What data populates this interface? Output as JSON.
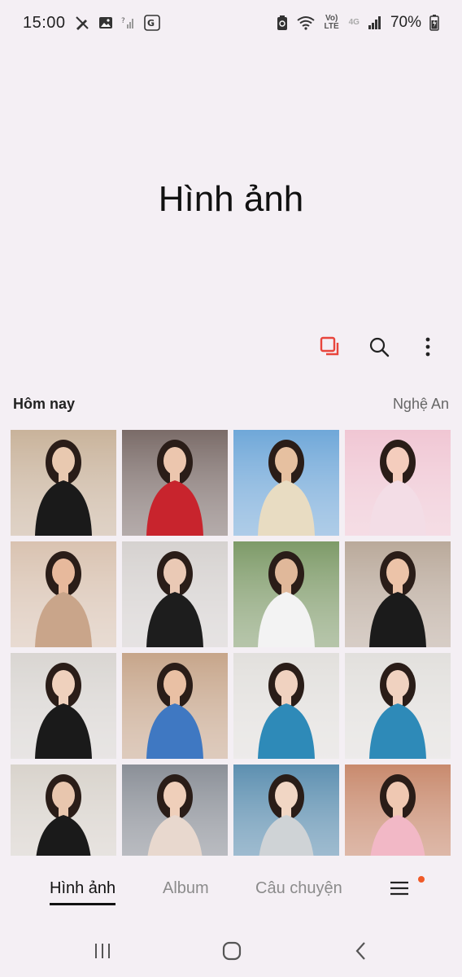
{
  "status_bar": {
    "time": "15:00",
    "left_icons": [
      "pen-off-icon",
      "image-icon",
      "signal-question-icon",
      "translate-icon"
    ],
    "right_icons": [
      "recycle-icon",
      "wifi-icon",
      "volte-icon",
      "4g-icon",
      "signal-icon",
      "battery-icon"
    ],
    "volte_label": "Vo) LTE",
    "network_label": "4G",
    "battery_percent": "70%"
  },
  "title": "Hình ảnh",
  "toolbar": {
    "icons": [
      "select-icon",
      "search-icon",
      "more-options-icon"
    ],
    "accent_color": "#e8453c"
  },
  "section": {
    "date_label": "Hôm nay",
    "location_label": "Nghệ An"
  },
  "photos": [
    {
      "bg": "#c9b39a",
      "accent": "#1a1a1a",
      "skin": "#e9c9b0"
    },
    {
      "bg": "#7a6b68",
      "accent": "#c8242d",
      "skin": "#ecc6ae"
    },
    {
      "bg": "#6fa7d8",
      "accent": "#e8dcc2",
      "skin": "#e6c0a0"
    },
    {
      "bg": "#f0c6d4",
      "accent": "#f3dde6",
      "skin": "#f4cdbd"
    },
    {
      "bg": "#d9c2b0",
      "accent": "#c9a58a",
      "skin": "#e7b99c"
    },
    {
      "bg": "#d6d2cf",
      "accent": "#1d1d1d",
      "skin": "#eac9b5"
    },
    {
      "bg": "#7d9a68",
      "accent": "#f3f3f3",
      "skin": "#e0b89a"
    },
    {
      "bg": "#b9a99a",
      "accent": "#1b1b1b",
      "skin": "#ecc3a8"
    },
    {
      "bg": "#d9d6d2",
      "accent": "#1a1a1a",
      "skin": "#efd1bd"
    },
    {
      "bg": "#c7a58a",
      "accent": "#3f78c2",
      "skin": "#e9c0a4"
    },
    {
      "bg": "#e2e0dd",
      "accent": "#2e8ab8",
      "skin": "#f0d2c0"
    },
    {
      "bg": "#e2e0dd",
      "accent": "#2e8ab8",
      "skin": "#f0d2c0"
    },
    {
      "bg": "#d8d3cc",
      "accent": "#1a1a1a",
      "skin": "#e8c6ae"
    },
    {
      "bg": "#8b8f98",
      "accent": "#e8d8ce",
      "skin": "#efcfba"
    },
    {
      "bg": "#5d8fb0",
      "accent": "#cfd3d6",
      "skin": "#f1d6c4"
    },
    {
      "bg": "#c98a6e",
      "accent": "#f2b8c6",
      "skin": "#efc8b2"
    }
  ],
  "tabs": [
    {
      "label": "Hình ảnh",
      "active": true
    },
    {
      "label": "Album",
      "active": false
    },
    {
      "label": "Câu chuyện",
      "active": false
    }
  ],
  "menu": {
    "icon": "hamburger-menu-icon",
    "badge_color": "#f05a28"
  },
  "nav": {
    "icons": [
      "recent-apps-icon",
      "home-icon",
      "back-icon"
    ]
  }
}
